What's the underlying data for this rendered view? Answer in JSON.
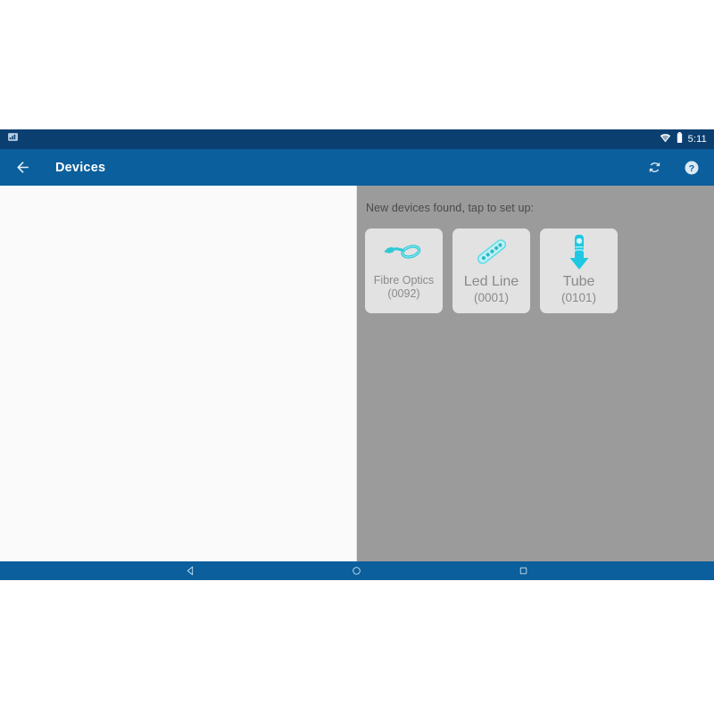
{
  "status_bar": {
    "notification_icon": "screenshot-icon",
    "wifi_icon": "wifi-icon",
    "battery_icon": "battery-icon",
    "clock": "5:11",
    "background_color": "#0b3f70"
  },
  "toolbar": {
    "back_icon": "arrow-back-icon",
    "title": "Devices",
    "refresh_icon": "refresh-icon",
    "help_icon": "help-circle-icon",
    "background_color": "#0a5f9c"
  },
  "left_pane": {
    "background_color": "#fafafa"
  },
  "right_pane": {
    "background_color": "#9b9b9b",
    "heading": "New devices found, tap to set up:",
    "devices": [
      {
        "name": "Fibre Optics",
        "id": "(0092)",
        "icon": "fibre-optic-cable-icon",
        "icon_color": "#29c7d4",
        "text_size": "small"
      },
      {
        "name": "Led Line",
        "id": "(0001)",
        "icon": "led-strip-icon",
        "icon_color": "#29c7d4",
        "text_size": "large"
      },
      {
        "name": "Tube",
        "id": "(0101)",
        "icon": "tube-lamp-icon",
        "icon_color": "#1ec8e0",
        "text_size": "large"
      }
    ]
  },
  "navbar": {
    "back_label": "back-nav",
    "home_label": "home-nav",
    "recents_label": "recents-nav",
    "background_color": "#0a5f9c"
  }
}
